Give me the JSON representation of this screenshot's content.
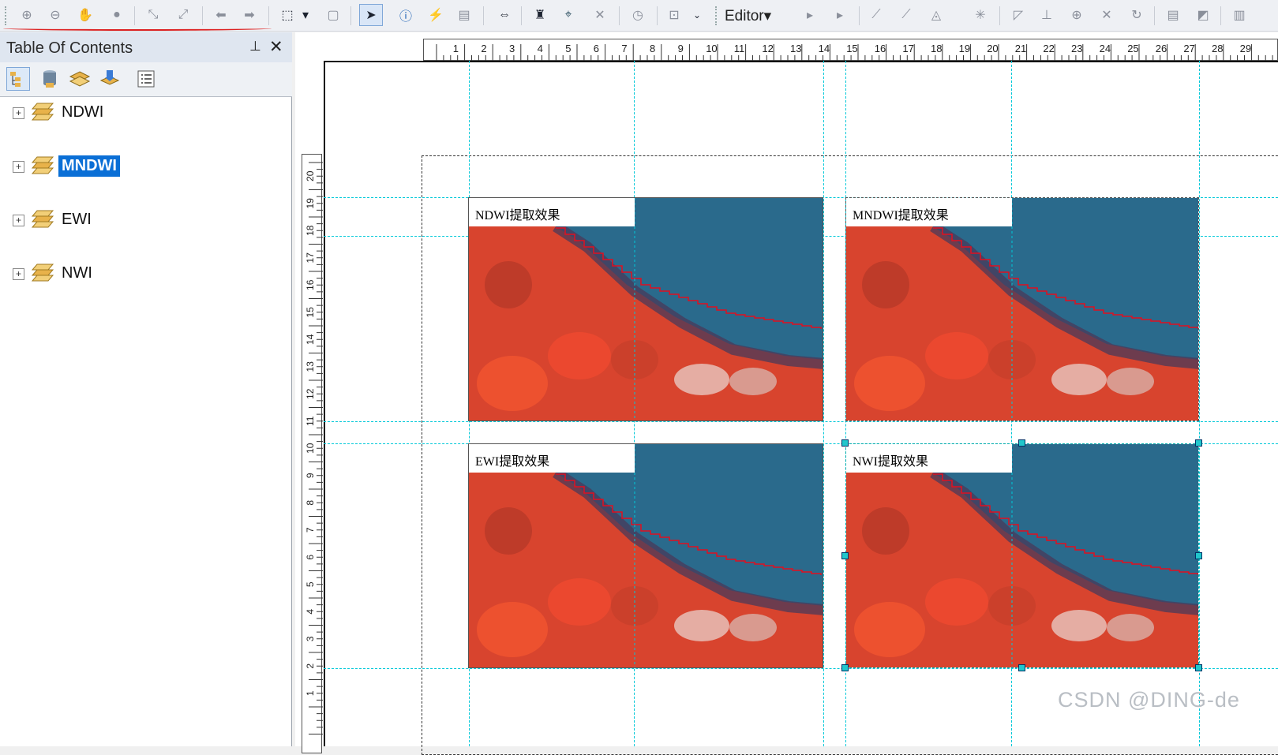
{
  "toolbar": {
    "editor_label": "Editor",
    "dropdown_arrow": "▾"
  },
  "toc": {
    "title": "Table Of Contents",
    "pin_glyph": "⊥",
    "close_glyph": "✕",
    "layers": [
      {
        "name": "NDWI",
        "selected": false
      },
      {
        "name": "MNDWI",
        "selected": true
      },
      {
        "name": "EWI",
        "selected": false
      },
      {
        "name": "NWI",
        "selected": false
      }
    ],
    "expander_glyph": "+"
  },
  "layout": {
    "hruler_labels": [
      "1",
      "2",
      "3",
      "4",
      "5",
      "6",
      "7",
      "8",
      "9",
      "10",
      "11",
      "12",
      "13",
      "14",
      "15",
      "16",
      "17",
      "18",
      "19",
      "20",
      "21",
      "22",
      "23",
      "24",
      "25",
      "26",
      "27",
      "28",
      "29"
    ],
    "vruler_labels": [
      "20",
      "19",
      "18",
      "17",
      "16",
      "15",
      "14",
      "13",
      "12",
      "11",
      "10",
      "9",
      "8",
      "7",
      "6",
      "5",
      "4",
      "3",
      "2",
      "1"
    ],
    "frames": [
      {
        "title": "NDWI提取效果"
      },
      {
        "title": "MNDWI提取效果"
      },
      {
        "title": "EWI提取效果"
      },
      {
        "title": "NWI提取效果"
      }
    ]
  },
  "colors": {
    "water": "#2a6a8c",
    "land": "#d8442e",
    "boundary": "#e01020",
    "guide": "#00c8d8",
    "selection": "#0a6fd6"
  },
  "watermark": "CSDN @DING-de"
}
